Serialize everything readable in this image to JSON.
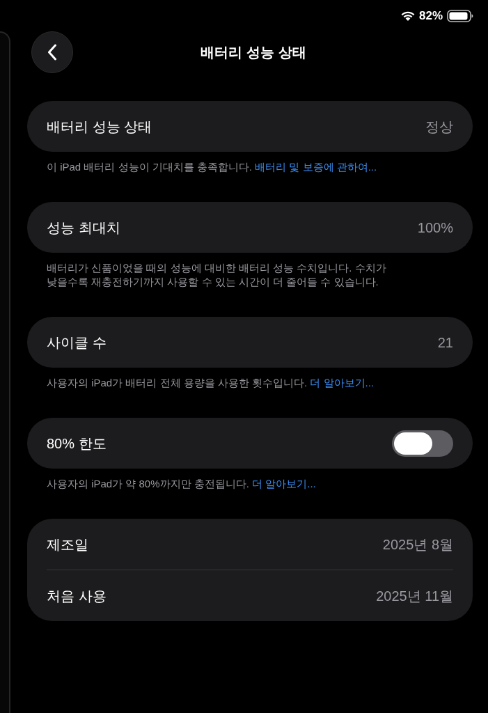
{
  "status_bar": {
    "battery_percent": "82%"
  },
  "nav": {
    "title": "배터리 성능 상태"
  },
  "sections": [
    {
      "rows": [
        {
          "kind": "value",
          "label": "배터리 성능 상태",
          "value": "정상"
        }
      ],
      "footer": {
        "text": "이 iPad 배터리 성능이 기대치를 충족합니다.",
        "link": "배터리 및 보증에 관하여..."
      }
    },
    {
      "rows": [
        {
          "kind": "value",
          "label": "성능 최대치",
          "value": "100%"
        }
      ],
      "footer": {
        "text": "배터리가 신품이었을 때의 성능에 대비한 배터리 성능 수치입니다. 수치가 낮을수록 재충전하기까지 사용할 수 있는 시간이 더 줄어들 수 있습니다."
      }
    },
    {
      "rows": [
        {
          "kind": "value",
          "label": "사이클 수",
          "value": "21"
        }
      ],
      "footer": {
        "text": "사용자의 iPad가 배터리 전체 용량을 사용한 횟수입니다.",
        "link": "더 알아보기..."
      }
    },
    {
      "rows": [
        {
          "kind": "toggle",
          "label": "80% 한도",
          "on": false
        }
      ],
      "footer": {
        "text": "사용자의 iPad가 약 80%까지만 충전됩니다.",
        "link": "더 알아보기..."
      }
    },
    {
      "rows": [
        {
          "kind": "value",
          "label": "제조일",
          "value": "2025년 8월"
        },
        {
          "kind": "value",
          "label": "처음 사용",
          "value": "2025년 11월"
        }
      ]
    }
  ]
}
